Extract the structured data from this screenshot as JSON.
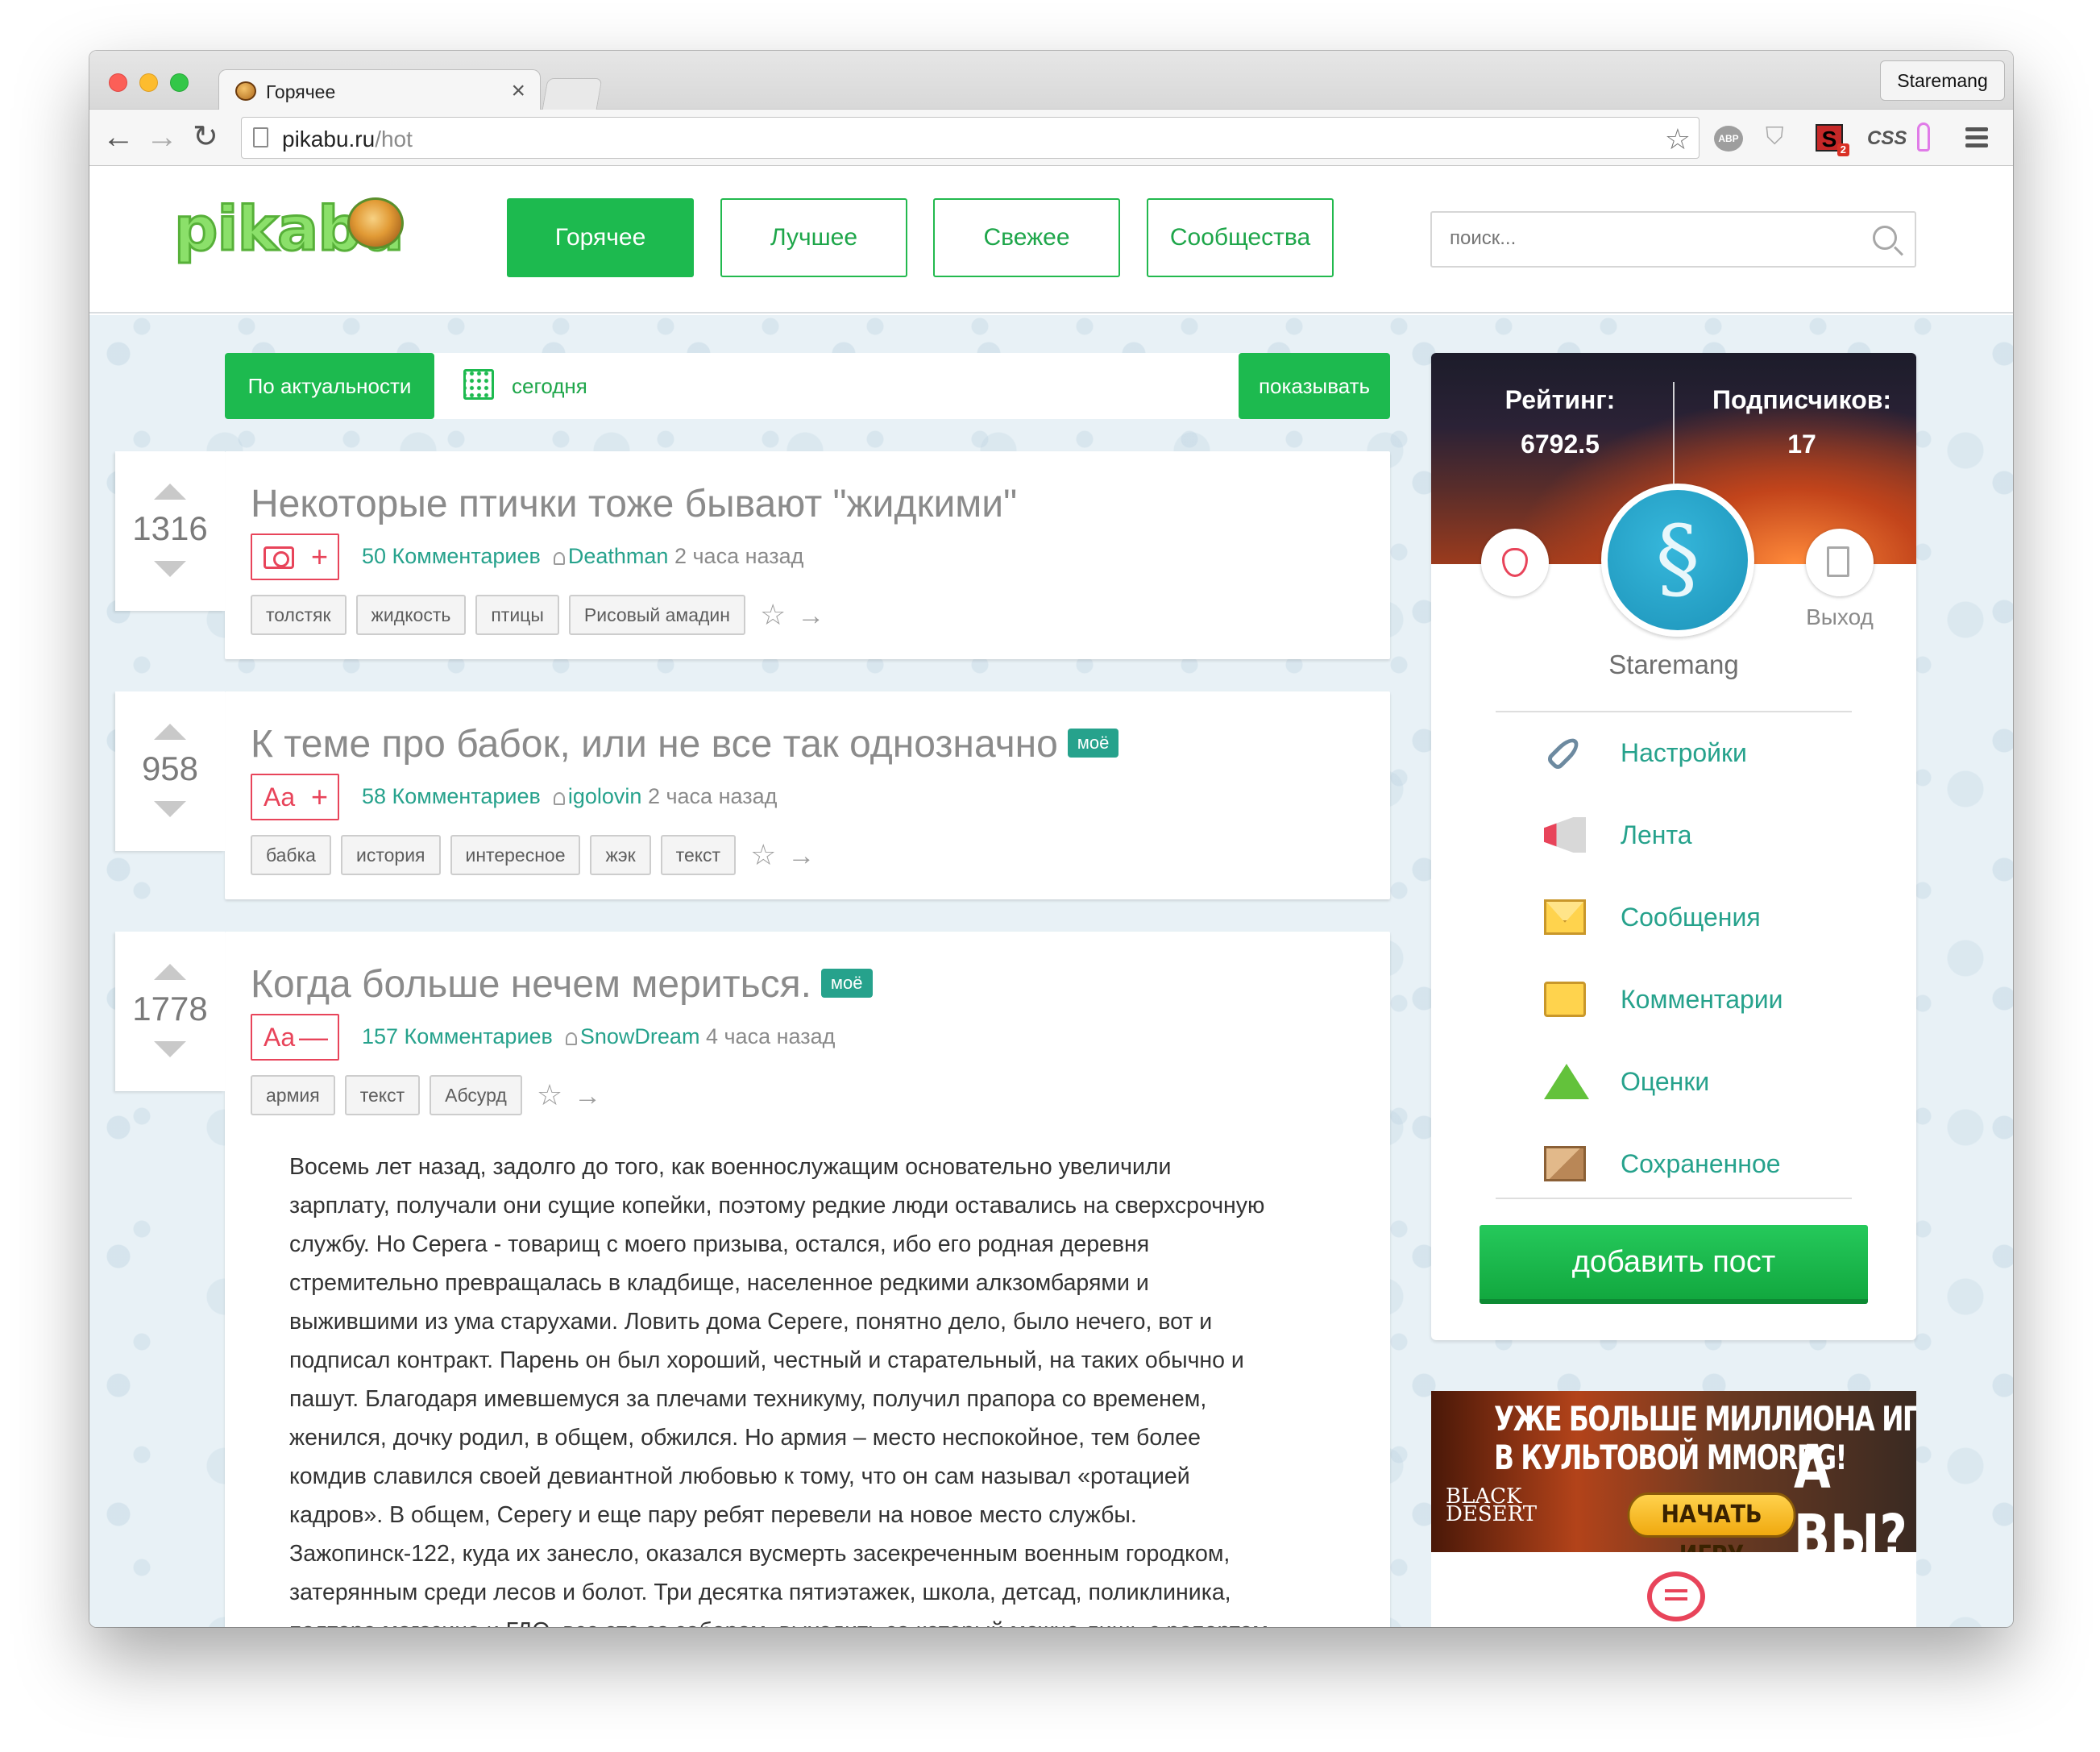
{
  "browser": {
    "tab_title": "Горячее",
    "tab_close": "×",
    "profile_name": "Staremang",
    "url_domain": "pikabu.ru",
    "url_path": "/hot",
    "nav": {
      "back": "←",
      "forward": "→",
      "reload": "↻"
    },
    "bookmark": "☆",
    "extensions": {
      "abp": "ABP",
      "s_badge": "2",
      "s_label": "S",
      "css": "CSS"
    }
  },
  "site": {
    "logo": "pikabu",
    "nav": [
      "Горячее",
      "Лучшее",
      "Свежее",
      "Сообщества"
    ],
    "search_placeholder": "поиск..."
  },
  "filter": {
    "sort_label": "По актуальности",
    "date_label": "сегодня",
    "show_label": "показывать"
  },
  "posts": [
    {
      "rating": "1316",
      "title": "Некоторые птички тоже бывают \"жидкими\"",
      "badge": "",
      "type": "photo",
      "type_action": "+",
      "comments": "50 Комментариев",
      "author": "Deathman",
      "time": "2 часа назад",
      "tags": [
        "толстяк",
        "жидкость",
        "птицы",
        "Рисовый амадин"
      ]
    },
    {
      "rating": "958",
      "title": "К теме про бабок, или не все так однозначно",
      "badge": "моё",
      "type": "Aa",
      "type_action": "+",
      "comments": "58 Комментариев",
      "author": "igolovin",
      "time": "2 часа назад",
      "tags": [
        "бабка",
        "история",
        "интересное",
        "жэк",
        "текст"
      ]
    },
    {
      "rating": "1778",
      "title": "Когда больше нечем мериться.",
      "badge": "моё",
      "type": "Aa",
      "type_action": "—",
      "comments": "157 Комментариев",
      "author": "SnowDream",
      "time": "4 часа назад",
      "tags": [
        "армия",
        "текст",
        "Абсурд"
      ],
      "body": [
        "Восемь лет назад, задолго до того, как военнослужащим основательно увеличили",
        "зарплату, получали они сущие копейки, поэтому редкие люди оставались на сверхсрочную",
        "службу. Но Серега - товарищ с моего призыва, остался, ибо его родная деревня",
        "стремительно превращалась в кладбище, населенное редкими алкзомбарями и",
        "выжившими из ума старухами. Ловить дома Сереге, понятно дело, было нечего, вот и",
        "подписал контракт. Парень он был хороший, честный и старательный, на таких обычно и",
        "пашут. Благодаря имевшемуся за плечами техникуму, получил прапора со временем,",
        "женился, дочку родил, в общем, обжился. Но армия – место неспокойное, тем более",
        "комдив славился своей девиантной любовью к тому, что он сам называл «ротацией",
        "кадров». В общем, Серегу и еще пару ребят перевели на новое место службы.",
        "Зажопинск-122, куда их занесло, оказался вусмерть засекреченным военным городком,",
        "затерянным среди лесов и болот. Три десятка пятиэтажек, школа, детсад, поликлиника,",
        "полтора магазина и ГДО, все это за забором, выходить за который можно лишь с рапортом"
      ]
    }
  ],
  "sidebar": {
    "rating_label": "Рейтинг:",
    "rating_value": "6792.5",
    "subs_label": "Подписчиков:",
    "subs_value": "17",
    "exit_label": "Выход",
    "username": "Staremang",
    "menu": [
      "Настройки",
      "Лента",
      "Сообщения",
      "Комментарии",
      "Оценки",
      "Сохраненное"
    ],
    "add_post": "добавить пост"
  },
  "ad": {
    "line1": "УЖЕ БОЛЬШЕ МИЛЛИОНА ИГРОКОВ",
    "line2": "В КУЛЬТОВОЙ MMORPG!",
    "question": "А ВЫ?",
    "brand": "BLACK DESERT",
    "cta": "НАЧАТЬ ИГРУ"
  },
  "colors": {
    "brand_green": "#1dba4f",
    "link_teal": "#26a28c",
    "accent_red": "#e8445a",
    "page_bg": "#e8f1f6"
  }
}
